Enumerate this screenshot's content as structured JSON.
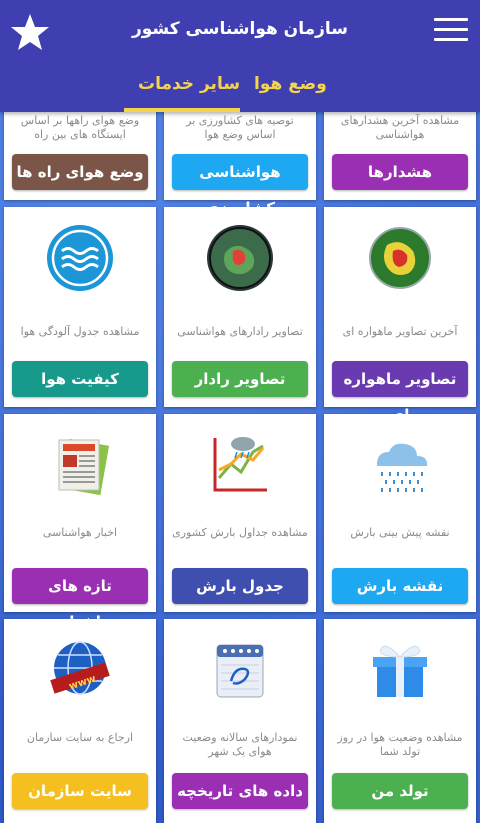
{
  "app": {
    "title": "سازمان هواشناسی کشور"
  },
  "tabs": [
    {
      "label": "وضع هوا"
    },
    {
      "label": "سایر خدمات"
    }
  ],
  "cards": [
    {
      "desc": "وضع هوای راهها بر اساس ایستگاه های بین راه",
      "button": "وضع هوای راه ها",
      "color": "#7a5548",
      "icon": ""
    },
    {
      "desc": "توصیه های کشاورزی بر اساس وضع هوا",
      "button": "هواشناسی کشاورزی",
      "color": "#1fa8f2",
      "icon": ""
    },
    {
      "desc": "مشاهده آخرین هشدارهای هواشناسی",
      "button": "هشدارها",
      "color": "#9b2fb3",
      "icon": ""
    },
    {
      "desc": "مشاهده جدول آلودگی هوا",
      "button": "کیفیت هوا",
      "color": "#179a8c",
      "icon": "air-quality-icon"
    },
    {
      "desc": "تصاویر رادارهای هواشناسی",
      "button": "تصاویر رادار",
      "color": "#4caf50",
      "icon": "radar-icon"
    },
    {
      "desc": "آخرین تصاویر ماهواره ای",
      "button": "تصاویر ماهواره ای",
      "color": "#6a3bb0",
      "icon": "satellite-icon"
    },
    {
      "desc": "اخبار هواشناسی",
      "button": "تازه های هواشناسی",
      "color": "#9b2fb3",
      "icon": "news-icon"
    },
    {
      "desc": "مشاهده جداول بارش کشوری",
      "button": "جدول بارش",
      "color": "#3f4fb0",
      "icon": "rain-chart-icon"
    },
    {
      "desc": "نقشه پیش بینی بارش",
      "button": "نقشه بارش",
      "color": "#1fa8f2",
      "icon": "rain-cloud-icon"
    },
    {
      "desc": "ارجاع به سایت سازمان",
      "button": "سایت سازمان",
      "color": "#f5bf1f",
      "icon": "globe-www-icon"
    },
    {
      "desc": "نمودارهای سالانه وضعیت هوای یک شهر",
      "button": "داده های تاریخچه ای",
      "color": "#9b2fb3",
      "icon": "calendar-icon"
    },
    {
      "desc": "مشاهده وضعیت هوا در روز تولد شما",
      "button": "تولد من",
      "color": "#4caf50",
      "icon": "gift-icon"
    }
  ]
}
